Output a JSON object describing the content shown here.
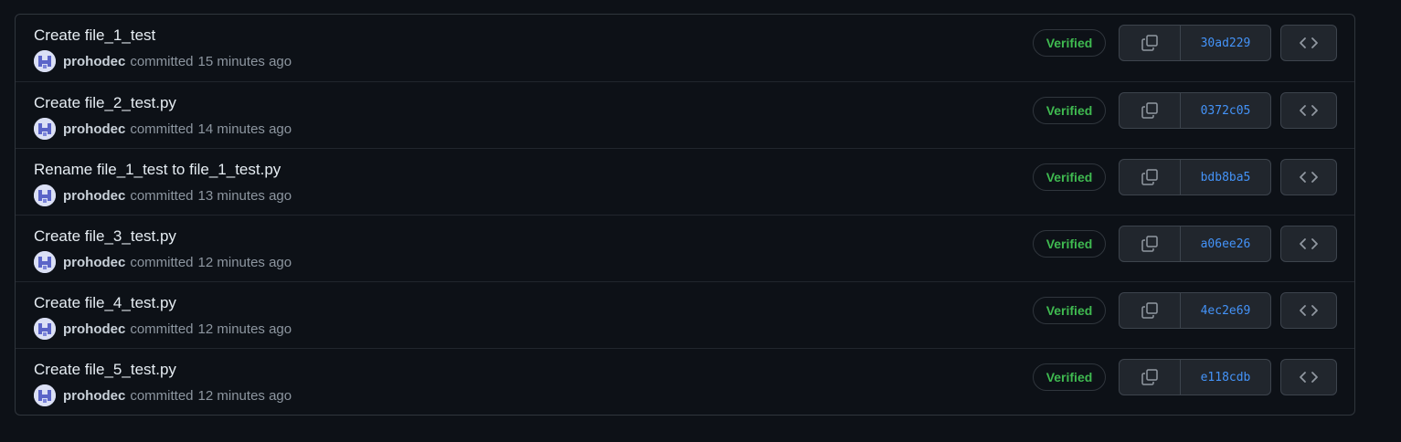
{
  "commits": [
    {
      "title": "Create file_1_test",
      "author": "prohodec",
      "committed_label": "committed",
      "time": "15 minutes ago",
      "badge": "Verified",
      "sha": "30ad229"
    },
    {
      "title": "Create file_2_test.py",
      "author": "prohodec",
      "committed_label": "committed",
      "time": "14 minutes ago",
      "badge": "Verified",
      "sha": "0372c05"
    },
    {
      "title": "Rename file_1_test to file_1_test.py",
      "author": "prohodec",
      "committed_label": "committed",
      "time": "13 minutes ago",
      "badge": "Verified",
      "sha": "bdb8ba5"
    },
    {
      "title": "Create file_3_test.py",
      "author": "prohodec",
      "committed_label": "committed",
      "time": "12 minutes ago",
      "badge": "Verified",
      "sha": "a06ee26"
    },
    {
      "title": "Create file_4_test.py",
      "author": "prohodec",
      "committed_label": "committed",
      "time": "12 minutes ago",
      "badge": "Verified",
      "sha": "4ec2e69"
    },
    {
      "title": "Create file_5_test.py",
      "author": "prohodec",
      "committed_label": "committed",
      "time": "12 minutes ago",
      "badge": "Verified",
      "sha": "e118cdb"
    }
  ],
  "icons": {
    "copy": "copy-icon",
    "browse": "code-icon",
    "avatar": "identicon"
  },
  "colors": {
    "background": "#0d1117",
    "verified": "#3fb950",
    "sha": "#4493f8",
    "title": "#e6edf3",
    "meta": "#8d96a0"
  }
}
